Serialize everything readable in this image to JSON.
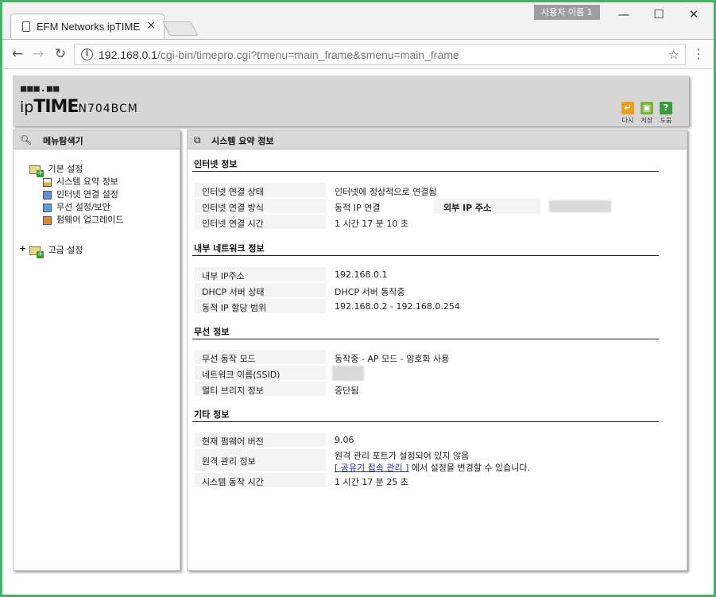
{
  "browser": {
    "tab_title": "EFM Networks ipTIME N",
    "tab_close": "×",
    "profile_label": "사용자 이름 1",
    "win_min": "—",
    "win_max": "☐",
    "win_close": "✕",
    "url_host": "192.168.0.1",
    "url_path": "/cgi-bin/timepro.cgi?tmenu=main_frame&smenu=main_frame",
    "icons": {
      "back": "arrow-left-icon",
      "forward": "arrow-right-icon",
      "reload": "reload-icon",
      "info": "info-icon",
      "star": "star-icon",
      "menu": "menu-dots-icon"
    }
  },
  "router": {
    "logo_dots": "■■■.■■",
    "logo_ip": "ip",
    "logo_time": "TIME",
    "model": "N704BCM",
    "buttons": {
      "back": "다시",
      "save": "저장",
      "help": "도움"
    }
  },
  "left_panel": {
    "title": "메뉴탐색기",
    "basic_label": "기본 설정",
    "basic_items": [
      "시스템 요약 정보",
      "인터넷 연결 설정",
      "무선 설정/보안",
      "펌웨어 업그레이드"
    ],
    "advanced_label": "고급 설정"
  },
  "right_panel": {
    "title": "시스템 요약 정보",
    "internet": {
      "title": "인터넷 정보",
      "rows": [
        {
          "key": "인터넷 연결 상태",
          "value": "인터넷에 정상적으로 연결됨"
        },
        {
          "key": "인터넷 연결 방식",
          "value": "동적 IP 연결"
        },
        {
          "key": "인터넷 연결 시간",
          "value": "1 시간 17 분 10 초"
        }
      ],
      "external_ip_label": "외부 IP 주소"
    },
    "lan": {
      "title": "내부 네트워크 정보",
      "rows": [
        {
          "key": "내부 IP주소",
          "value": "192.168.0.1"
        },
        {
          "key": "DHCP 서버 상태",
          "value": "DHCP 서버 동작중"
        },
        {
          "key": "동적 IP 할당 범위",
          "value": "192.168.0.2 -  192.168.0.254"
        }
      ]
    },
    "wireless": {
      "title": "무선 정보",
      "rows": [
        {
          "key": "무선 동작 모드",
          "value": "동작중 - AP 모드 - 암호화 사용"
        },
        {
          "key": "네트워크 이름(SSID)",
          "value": ""
        },
        {
          "key": "멀티 브리지 정보",
          "value": "중단됨"
        }
      ]
    },
    "other": {
      "title": "기타 정보",
      "firmware_key": "현재 펌웨어 버전",
      "firmware_value": "9.06",
      "remote_key": "원격 관리 정보",
      "remote_line1": "원격 관리 포트가 설정되어 있지 않음",
      "remote_link": "[ 공유기 접속 관리 ]",
      "remote_line2_suffix": " 에서 설정을 변경할 수 있습니다.",
      "uptime_key": "시스템 동작 시간",
      "uptime_value": "1 시간 17 분 25 초"
    }
  }
}
